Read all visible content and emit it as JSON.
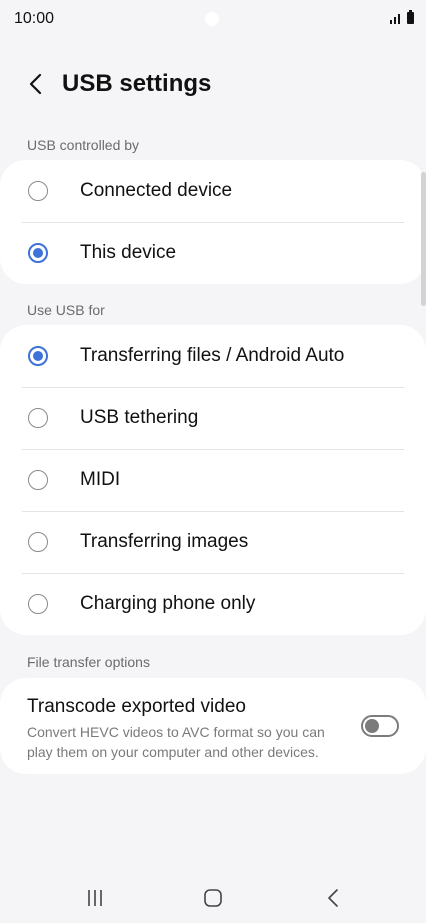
{
  "status_bar": {
    "time": "10:00"
  },
  "header": {
    "title": "USB settings"
  },
  "usb_controlled_by": {
    "label": "USB controlled by",
    "options": [
      {
        "label": "Connected device",
        "checked": false
      },
      {
        "label": "This device",
        "checked": true
      }
    ]
  },
  "use_usb_for": {
    "label": "Use USB for",
    "options": [
      {
        "label": "Transferring files / Android Auto",
        "checked": true
      },
      {
        "label": "USB tethering",
        "checked": false
      },
      {
        "label": "MIDI",
        "checked": false
      },
      {
        "label": "Transferring images",
        "checked": false
      },
      {
        "label": "Charging phone only",
        "checked": false
      }
    ]
  },
  "file_transfer": {
    "label": "File transfer options",
    "transcode": {
      "title": "Transcode exported video",
      "description": "Convert HEVC videos to AVC format so you can play them on your computer and other devices.",
      "enabled": false
    }
  },
  "colors": {
    "accent": "#3d72d9",
    "background": "#f5f5f7",
    "card": "#ffffff"
  },
  "icons": {
    "back": "back-arrow-icon",
    "recents": "recents-icon",
    "home": "home-icon",
    "nav_back": "nav-back-icon"
  }
}
